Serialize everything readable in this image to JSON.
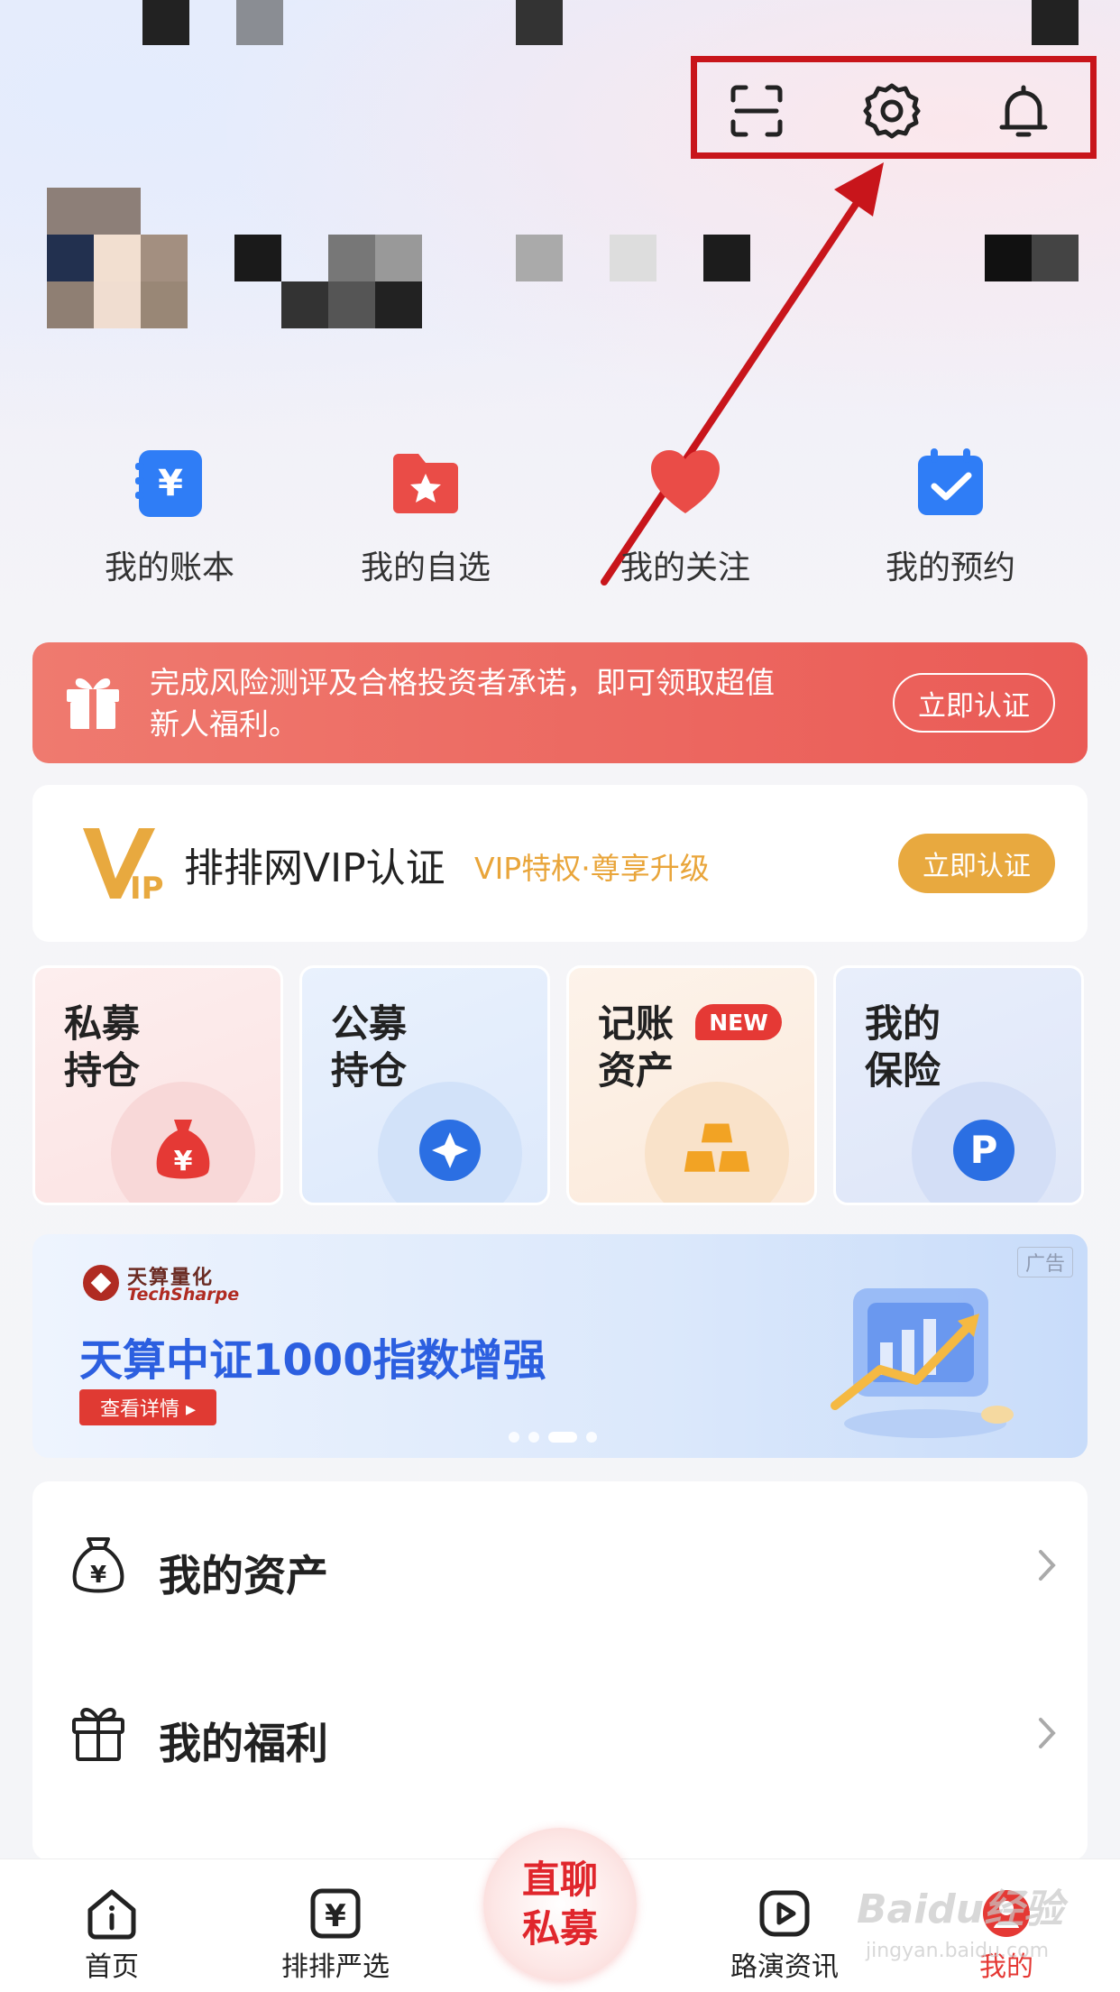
{
  "header": {
    "icons": [
      "scan-icon",
      "gear-icon",
      "bell-icon"
    ]
  },
  "quick_actions": [
    {
      "label": "我的账本",
      "icon": "ledger-icon"
    },
    {
      "label": "我的自选",
      "icon": "star-folder-icon"
    },
    {
      "label": "我的关注",
      "icon": "heart-icon"
    },
    {
      "label": "我的预约",
      "icon": "calendar-check-icon"
    }
  ],
  "risk_banner": {
    "text": "完成风险测评及合格投资者承诺，即可领取超值新人福利。",
    "button": "立即认证"
  },
  "vip": {
    "title": "排排网VIP认证",
    "subtitle": "VIP特权·尊享升级",
    "button": "立即认证"
  },
  "tiles": [
    {
      "line1": "私募",
      "line2": "持仓",
      "badge": ""
    },
    {
      "line1": "公募",
      "line2": "持仓",
      "badge": ""
    },
    {
      "line1": "记账",
      "line2": "资产",
      "badge": "NEW"
    },
    {
      "line1": "我的",
      "line2": "保险",
      "badge": ""
    }
  ],
  "ad": {
    "brand_cn": "天算量化",
    "brand_en": "TechSharpe",
    "title": "天算中证1000指数增强",
    "button": "查看详情 ▸",
    "tag": "广告",
    "dots": 4,
    "active_dot": 2
  },
  "list": [
    {
      "label": "我的资产",
      "icon": "money-bag-icon"
    },
    {
      "label": "我的福利",
      "icon": "gift-icon"
    }
  ],
  "tab_bar": {
    "tabs": [
      {
        "label": "首页",
        "icon": "home-icon"
      },
      {
        "label": "排排严选",
        "icon": "yuan-icon"
      },
      {
        "label": "路演资讯",
        "icon": "play-icon"
      },
      {
        "label": "我的",
        "icon": "profile-icon"
      }
    ],
    "center_line1": "直聊",
    "center_line2": "私募"
  },
  "watermark": {
    "main": "Baidu经验",
    "sub": "jingyan.baidu.com"
  },
  "colors": {
    "accent_red": "#e53935",
    "highlight_box": "#c8151b",
    "vip_gold": "#e8a93f",
    "ad_blue": "#2c5fe0"
  }
}
